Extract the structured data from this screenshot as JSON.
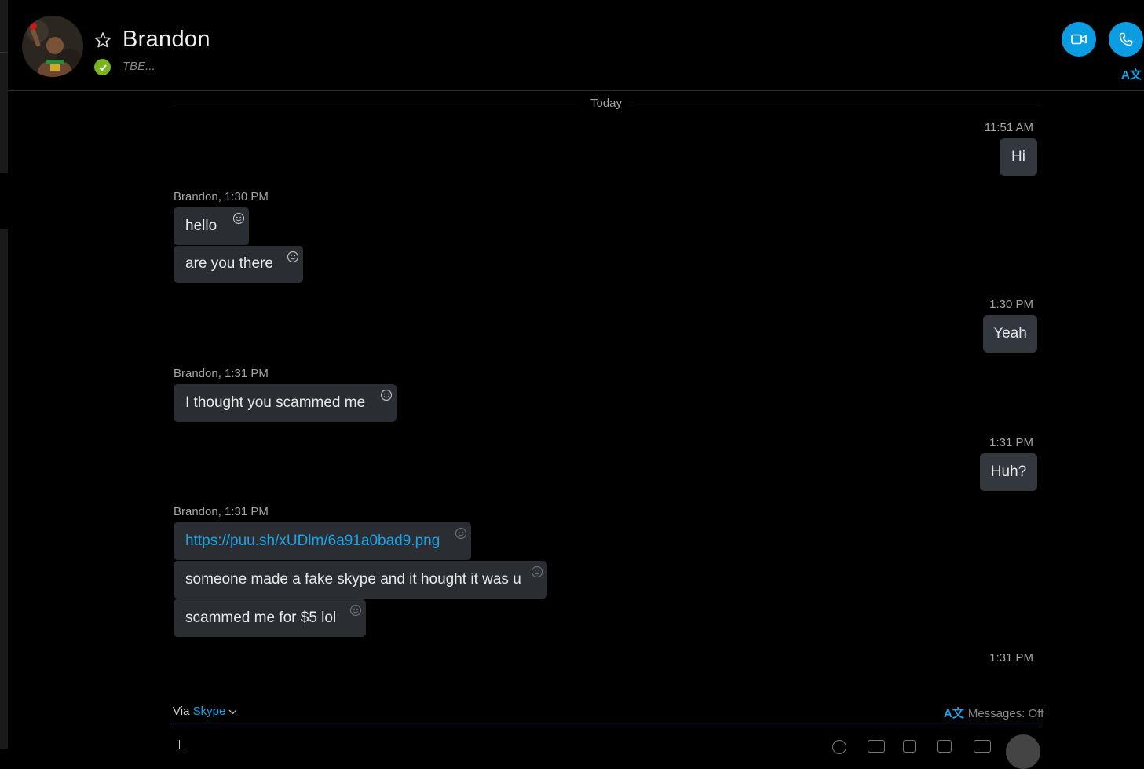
{
  "contact": {
    "name": "Brandon",
    "mood": "TBE...",
    "status": "online"
  },
  "header": {
    "video_call_icon": "video-icon",
    "audio_call_icon": "phone-icon",
    "translate_label": "A文"
  },
  "conversation": {
    "day_label": "Today",
    "messages": [
      {
        "sender": "me",
        "time": "11:51 AM",
        "bubbles": [
          "Hi"
        ]
      },
      {
        "sender": "Brandon",
        "header": "Brandon, 1:30 PM",
        "bubbles": [
          "hello",
          "are you there"
        ]
      },
      {
        "sender": "me",
        "time": "1:30 PM",
        "bubbles": [
          "Yeah"
        ]
      },
      {
        "sender": "Brandon",
        "header": "Brandon, 1:31 PM",
        "bubbles": [
          "I thought you scammed me"
        ]
      },
      {
        "sender": "me",
        "time": "1:31 PM",
        "bubbles": [
          "Huh?"
        ]
      },
      {
        "sender": "Brandon",
        "header": "Brandon, 1:31 PM",
        "bubbles": [
          "https://puu.sh/xUDlm/6a91a0bad9.png",
          "someone made a fake skype and it hought it was u",
          "scammed me for $5 lol"
        ]
      },
      {
        "sender": "me",
        "time": "1:31 PM",
        "bubbles": []
      }
    ]
  },
  "composer": {
    "via_label": "Via",
    "via_service": "Skype",
    "translate_icon": "A文",
    "messages_status": "Messages: Off"
  },
  "colors": {
    "accent": "#0c9ce2",
    "online": "#7ab51d",
    "bubble_theirs": "#2a2d31",
    "bubble_mine": "#33383f"
  }
}
